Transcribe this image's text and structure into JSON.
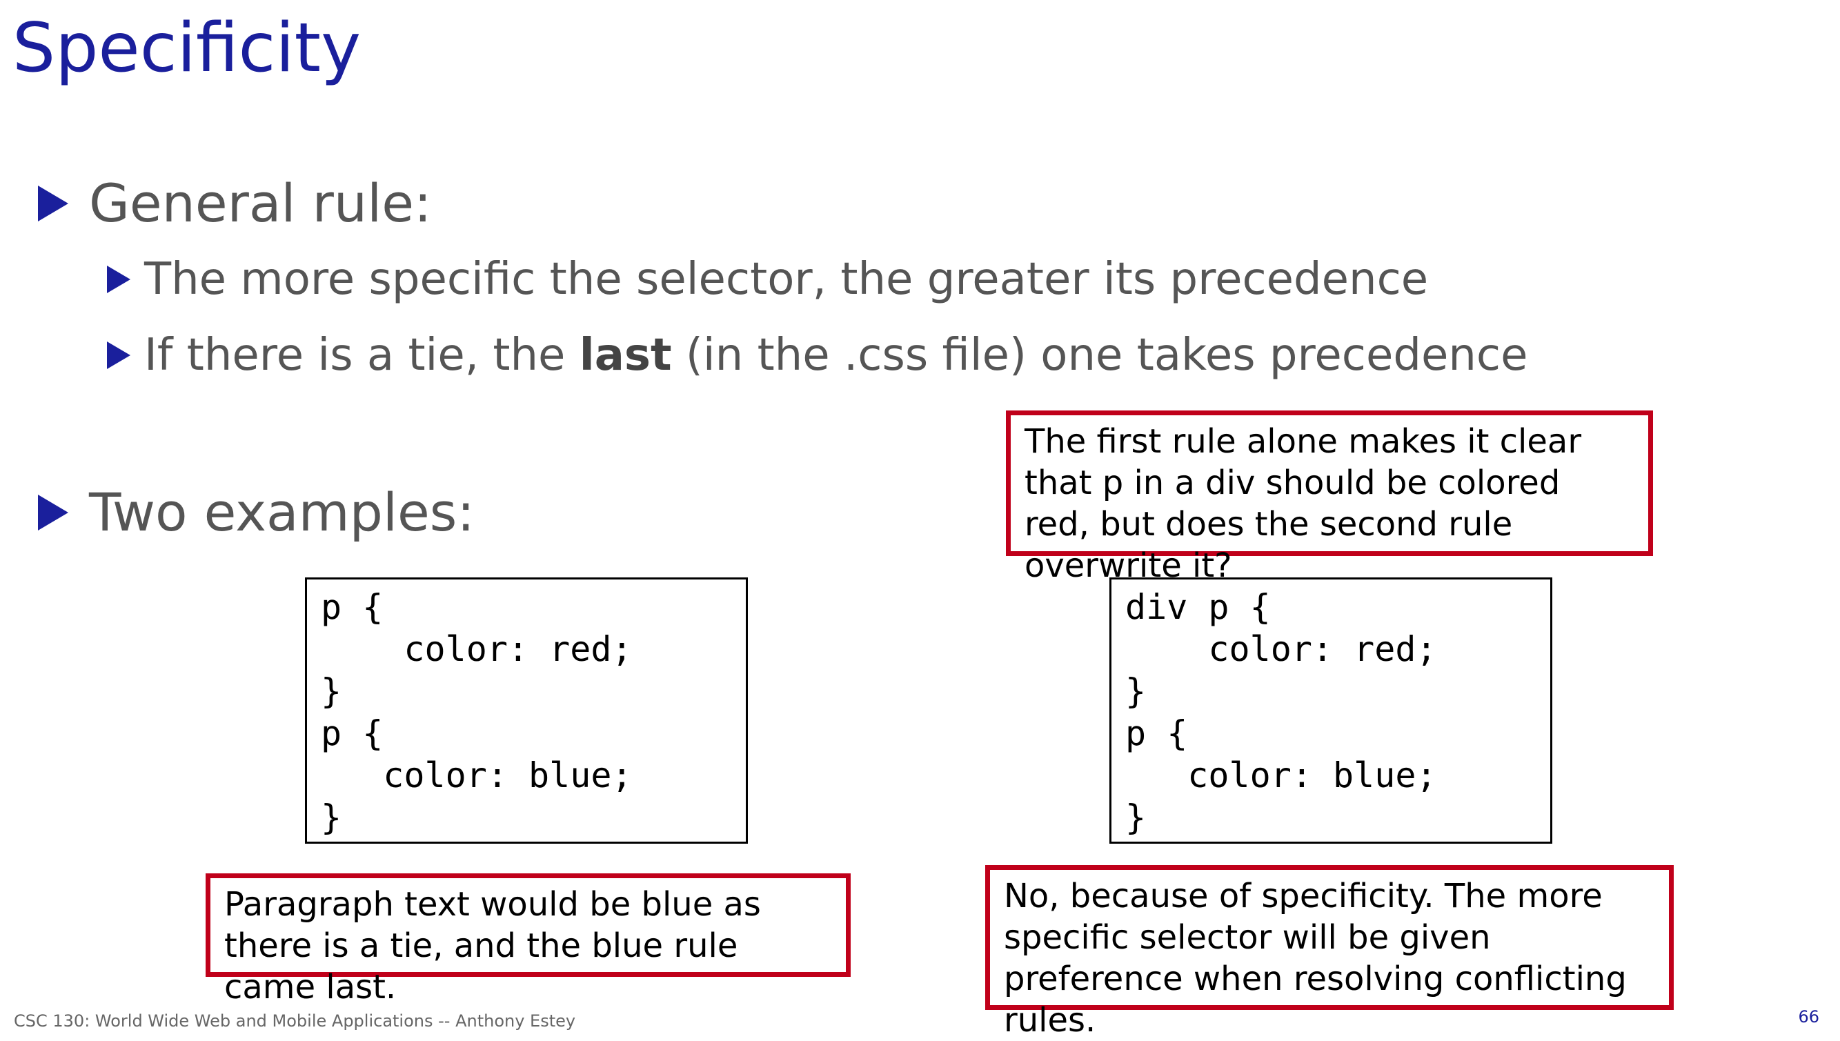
{
  "slide": {
    "title": "Specificity",
    "bullets": {
      "general_rule": "General rule:",
      "rule_more_specific": "The more specific the selector, the greater its precedence",
      "rule_tie_before": "If there is a tie, the ",
      "rule_tie_bold": "last",
      "rule_tie_after": " (in the .css file) one takes precedence",
      "two_examples": "Two examples:"
    },
    "example1": {
      "code": "p {\n    color: red;\n}\np {\n   color: blue;\n}",
      "callout": "Paragraph text would be blue as there is a tie, and the blue rule came last."
    },
    "example2": {
      "question_callout": "The first rule alone makes it clear that p in a div should be colored red, but does the second rule overwrite it?",
      "code": "div p {\n    color: red;\n}\np {\n   color: blue;\n}",
      "answer_callout": "No, because of specificity. The more specific selector will be given preference when resolving conflicting rules."
    },
    "footer": "CSC 130: World Wide Web and Mobile Applications -- Anthony Estey",
    "page_number": "66"
  },
  "colors": {
    "title": "#1a1f9c",
    "body_text": "#555555",
    "callout_border": "#c0001a"
  },
  "icons": {
    "bullet": "triangle-right-icon"
  }
}
